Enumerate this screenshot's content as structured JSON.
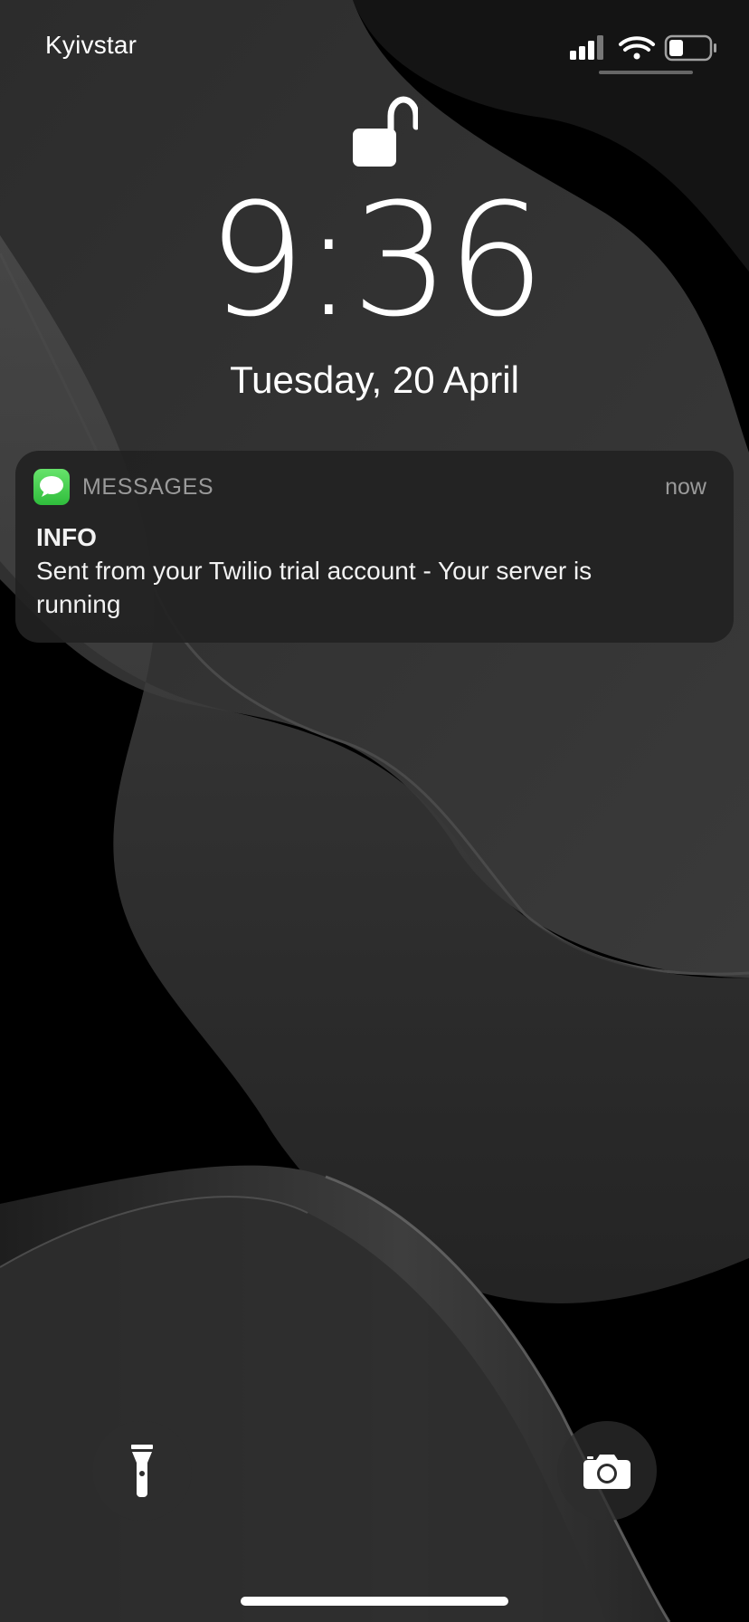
{
  "status_bar": {
    "carrier": "Kyivstar",
    "signal_icon": "cellular-signal-icon",
    "wifi_icon": "wifi-icon",
    "battery_icon": "battery-icon",
    "battery_level": 0.3
  },
  "lock_screen": {
    "lock_icon": "unlocked-padlock-icon",
    "time": "9:36",
    "date": "Tuesday, 20 April"
  },
  "notification": {
    "app_icon": "messages-app-icon",
    "app_name": "MESSAGES",
    "time": "now",
    "title": "INFO",
    "body": "Sent from your Twilio trial account - Your server is running"
  },
  "quick_actions": {
    "left": "flashlight-icon",
    "right": "camera-icon"
  },
  "colors": {
    "background": "#000000",
    "notification_bg": "#222222",
    "secondary_text": "#9a9a9a",
    "messages_green": "#34c759"
  }
}
